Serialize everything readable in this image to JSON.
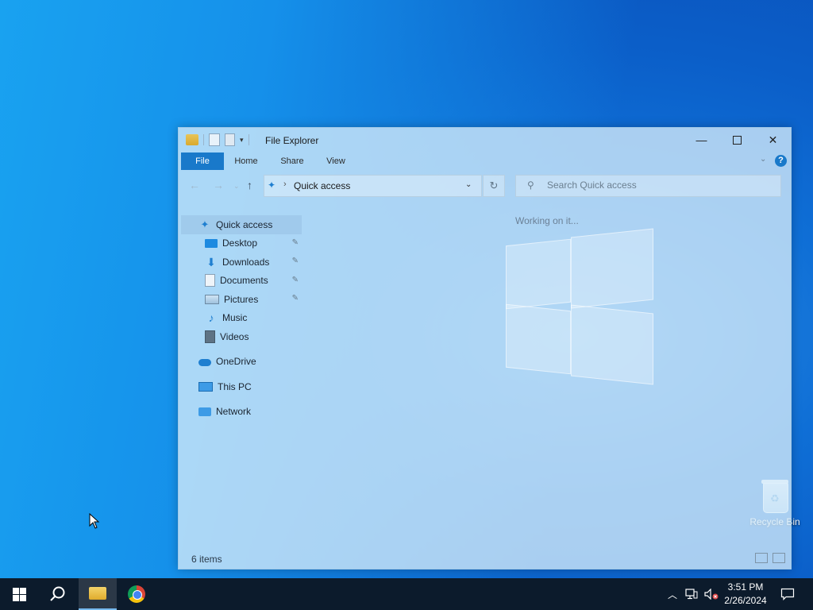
{
  "desktop": {
    "recycle_bin_label": "Recycle Bin"
  },
  "window": {
    "title": "File Explorer",
    "ribbon_tabs": [
      "File",
      "Home",
      "Share",
      "View"
    ],
    "address": "Quick access",
    "search_placeholder": "Search Quick access",
    "working_text": "Working on it...",
    "status_text": "6 items"
  },
  "sidebar": {
    "items": [
      {
        "label": "Quick access",
        "icon": "star-pin-icon",
        "pinned": false
      },
      {
        "label": "Desktop",
        "icon": "desktop-icon",
        "pinned": true
      },
      {
        "label": "Downloads",
        "icon": "download-arrow-icon",
        "pinned": true
      },
      {
        "label": "Documents",
        "icon": "document-icon",
        "pinned": true
      },
      {
        "label": "Pictures",
        "icon": "pictures-icon",
        "pinned": true
      },
      {
        "label": "Music",
        "icon": "music-note-icon",
        "pinned": false
      },
      {
        "label": "Videos",
        "icon": "video-icon",
        "pinned": false
      },
      {
        "label": "OneDrive",
        "icon": "cloud-icon",
        "pinned": false
      },
      {
        "label": "This PC",
        "icon": "computer-icon",
        "pinned": false
      },
      {
        "label": "Network",
        "icon": "network-icon",
        "pinned": false
      }
    ]
  },
  "taskbar": {
    "time": "3:51 PM",
    "date": "2/26/2024"
  },
  "colors": {
    "accent": "#1979ca",
    "taskbar": "#0c1b2c"
  }
}
